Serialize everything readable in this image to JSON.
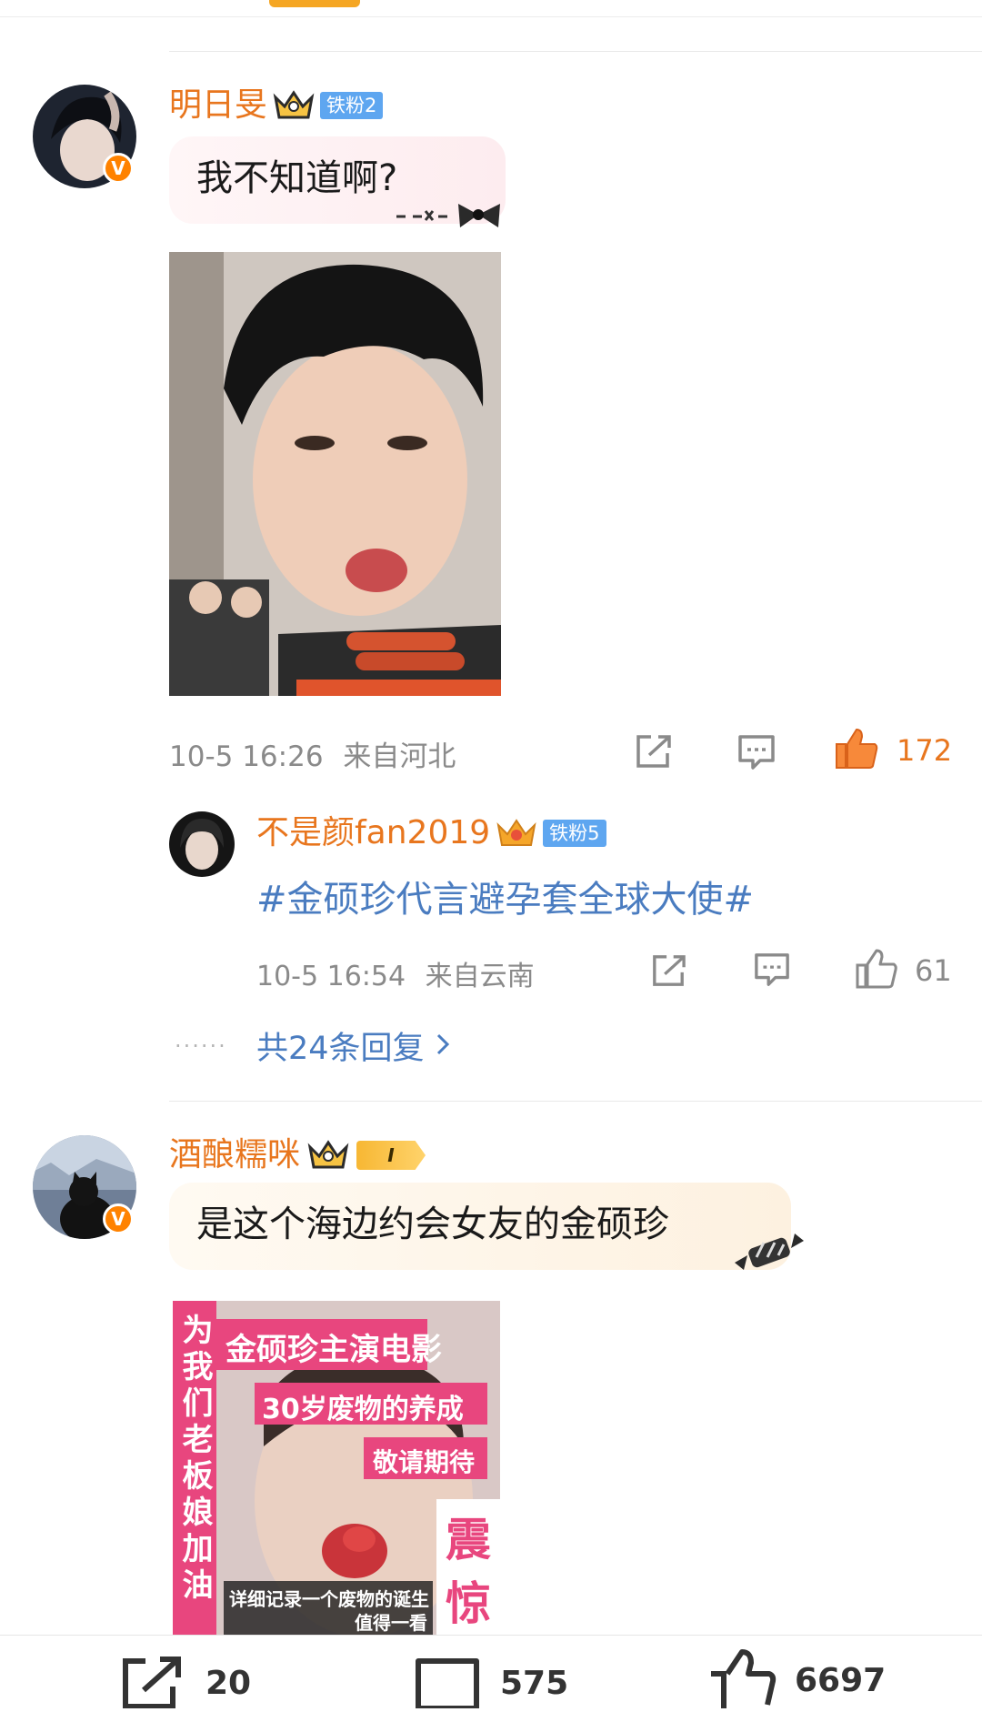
{
  "comments": [
    {
      "username": "明日旻",
      "fan_badge": "铁粉2",
      "text": "我不知道啊?",
      "time": "10-5 16:26",
      "location": "来自河北",
      "likes": "172",
      "reply": {
        "username": "不是颜fan2019",
        "fan_badge": "铁粉5",
        "text": "#金硕珍代言避孕套全球大使#",
        "time": "10-5 16:54",
        "location": "来自云南",
        "likes": "61"
      },
      "more_replies": "共24条回复"
    },
    {
      "username": "酒酿糯咪",
      "fan_badge": "I",
      "text": "是这个海边约会女友的金硕珍",
      "poster": {
        "title": "金硕珍主演电影",
        "subtitle": "30岁废物的养成",
        "tagline": "敬请期待",
        "side_text": "为我们老板娘加油",
        "badge_text": "震惊",
        "caption_line1": "详细记录一个废物的诞生",
        "caption_line2": "值得一看"
      }
    }
  ],
  "bottom_bar": {
    "repost_count": "20",
    "comment_count": "575",
    "like_count": "6697"
  },
  "colors": {
    "accent": "#e8761e",
    "link": "#4a7cc0",
    "verified": "#ff8200"
  }
}
